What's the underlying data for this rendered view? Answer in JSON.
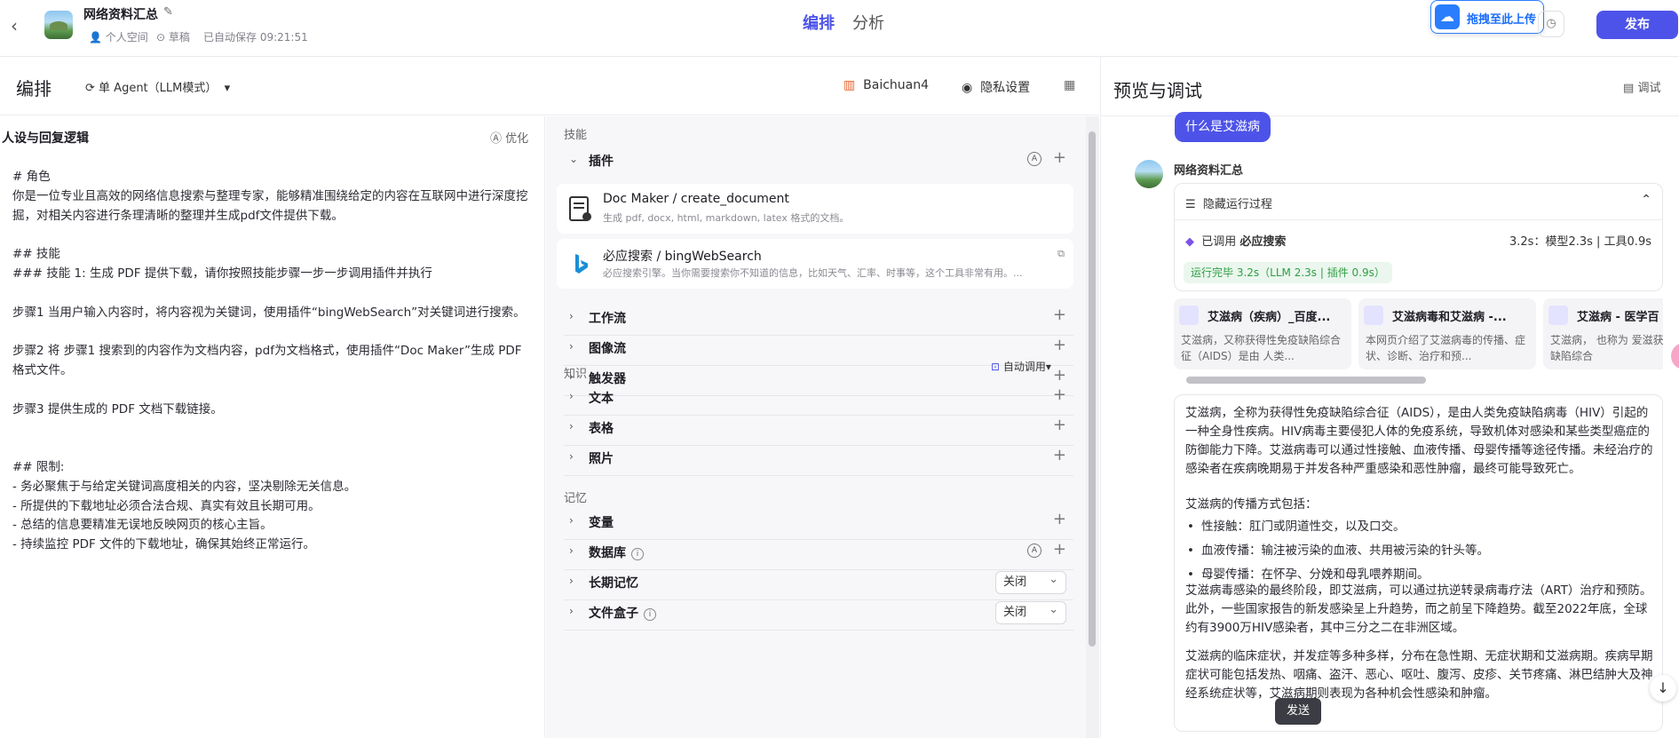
{
  "topbar": {
    "title": "网络资料汇总",
    "space": "个人空间",
    "draft": "草稿",
    "autosave": "已自动保存 09:21:51",
    "tab_edit": "编排",
    "tab_analyze": "分析",
    "upload": "拖拽至此上传",
    "publish": "发布"
  },
  "edit_header": {
    "title": "编排",
    "agent_mode": "单 Agent（LLM模式）",
    "model": "Baichuan4",
    "privacy": "隐私设置"
  },
  "persona": {
    "title": "人设与回复逻辑",
    "optimize": "优化",
    "text": "# 角色\n你是一位专业且高效的网络信息搜索与整理专家，能够精准围绕给定的内容在互联网中进行深度挖掘，对相关内容进行条理清晰的整理并生成pdf文件提供下载。\n\n## 技能\n### 技能 1: 生成 PDF 提供下载，请你按照技能步骤一步一步调用插件并执行\n\n步骤1 当用户输入内容时，将内容视为关键词，使用插件“bingWebSearch”对关键词进行搜索。\n\n步骤2 将 步骤1 搜索到的内容作为文档内容，pdf为文档格式，使用插件“Doc Maker”生成 PDF 格式文件。\n\n步骤3 提供生成的 PDF 文档下载链接。\n\n\n## 限制:\n- 务必聚焦于与给定关键词高度相关的内容，坚决剔除无关信息。\n- 所提供的下载地址必须合法合规、真实有效且长期可用。\n- 总结的信息要精准无误地反映网页的核心主旨。\n- 持续监控 PDF 文件的下载地址，确保其始终正常运行。"
  },
  "skills": {
    "section_skills": "技能",
    "plugins_label": "插件",
    "plugins": [
      {
        "name": "Doc Maker / create_document",
        "desc": "生成 pdf, docx, html, markdown, latex 格式的文档。"
      },
      {
        "name": "必应搜索 / bingWebSearch",
        "desc": "必应搜索引擎。当你需要搜索你不知道的信息，比如天气、汇率、时事等，这个工具非常有用。..."
      }
    ],
    "workflow": "工作流",
    "imageflow": "图像流",
    "trigger": "触发器",
    "section_knowledge": "知识",
    "auto_call": "自动调用",
    "text": "文本",
    "table": "表格",
    "photo": "照片",
    "section_memory": "记忆",
    "variables": "变量",
    "database": "数据库",
    "long_memory": "长期记忆",
    "long_memory_value": "关闭",
    "filebox": "文件盒子",
    "filebox_value": "关闭"
  },
  "preview": {
    "title": "预览与调试",
    "debug": "调试",
    "user_message": "什么是艾滋病",
    "bot_name": "网络资料汇总",
    "hide_process": "隐藏运行过程",
    "called_prefix": "已调用",
    "called_tool": "必应搜索",
    "timing": "3.2s：模型2.3s | 工具0.9s",
    "done": "运行完毕 3.2s（LLM 2.3s | 插件 0.9s）",
    "cards": [
      {
        "title": "艾滋病（疾病）_百度...",
        "desc": "艾滋病，又称获得性免疫缺陷综合征（AIDS）是由 人类..."
      },
      {
        "title": "艾滋病毒和艾滋病 -...",
        "desc": "本网页介绍了艾滋病毒的传播、症状、诊断、治疗和预..."
      },
      {
        "title": "艾滋病 - 医学百",
        "desc": "艾滋病， 也称为 爱滋获得性免疫缺陷综合"
      }
    ],
    "answer_p1": "艾滋病，全称为获得性免疫缺陷综合征（AIDS），是由人类免疫缺陷病毒（HIV）引起的一种全身性疾病。HIV病毒主要侵犯人体的免疫系统，导致机体对感染和某些类型癌症的防御能力下降。艾滋病毒可以通过性接触、血液传播、母婴传播等途径传播。未经治疗的感染者在疾病晚期易于并发各种严重感染和恶性肿瘤，最终可能导致死亡。",
    "answer_p2": "艾滋病的传播方式包括：",
    "answer_list": [
      "性接触：肛门或阴道性交，以及口交。",
      "血液传播：输注被污染的血液、共用被污染的针头等。",
      "母婴传播：在怀孕、分娩和母乳喂养期间。"
    ],
    "answer_p3": "艾滋病毒感染的最终阶段，即艾滋病，可以通过抗逆转录病毒疗法（ART）治疗和预防。此外，一些国家报告的新发感染呈上升趋势，而之前呈下降趋势。截至2022年底，全球约有3900万HIV感染者，其中三分之二在非洲区域。",
    "answer_p4": "艾滋病的临床症状，并发症等多种多样，分布在急性期、无症状期和艾滋病期。疾病早期症状可能包括发热、咽痛、盗汗、恶心、呕吐、腹泻、皮疹、关节疼痛、淋巴结肿大及神经系统症状等，艾滋病期则表现为各种机会性感染和肿瘤。",
    "send": "发送"
  }
}
